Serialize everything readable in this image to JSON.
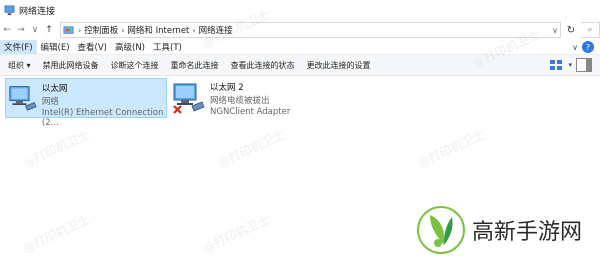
{
  "window": {
    "title": "网络连接"
  },
  "address": {
    "crumbs": [
      "控制面板",
      "网络和 Internet",
      "网络连接"
    ]
  },
  "menu": [
    "文件(F)",
    "编辑(E)",
    "查看(V)",
    "高级(N)",
    "工具(T)"
  ],
  "toolbar": [
    "组织 ▾",
    "禁用此网络设备",
    "诊断这个连接",
    "重命名此连接",
    "查看此连接的状态",
    "更改此连接的设置"
  ],
  "connections": [
    {
      "name": "以太网",
      "status": "网络",
      "adapter": "Intel(R) Ethernet Connection (2..."
    },
    {
      "name": "以太网 2",
      "status": "网络电缆被拔出",
      "adapter": "NGNClient Adapter"
    }
  ],
  "watermark": "@打印机卫士",
  "brand": {
    "text": "高新手游网"
  }
}
